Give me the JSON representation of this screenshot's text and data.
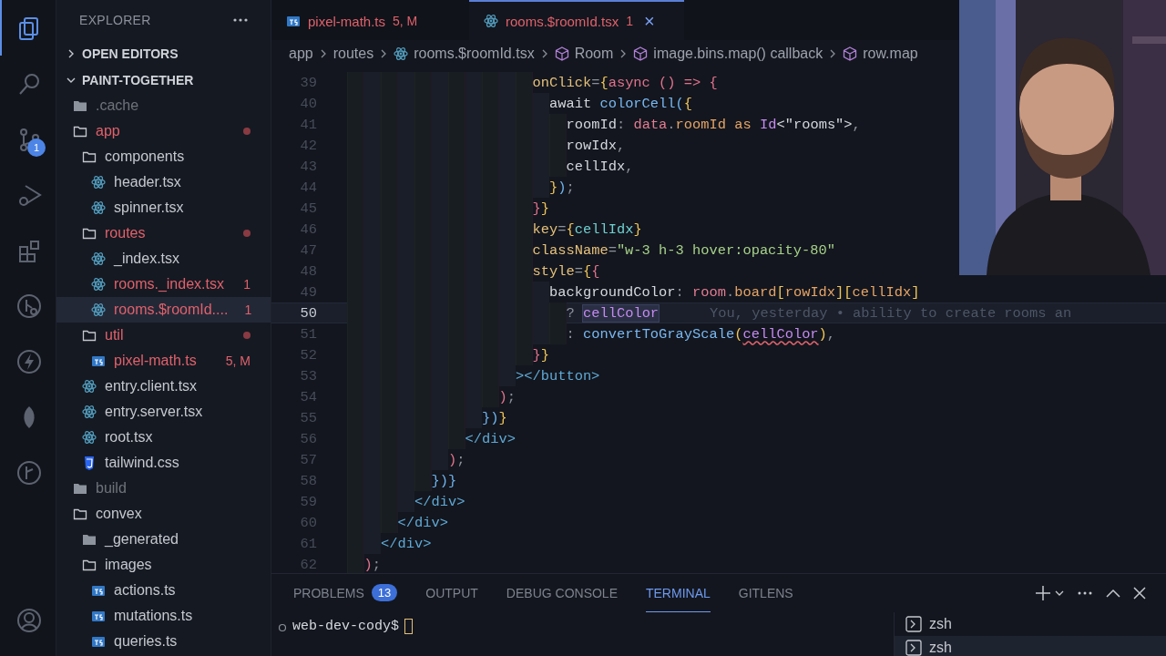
{
  "activity_bar": [
    {
      "kind": "files",
      "selected": true
    },
    {
      "kind": "search",
      "selected": false
    },
    {
      "kind": "source-control",
      "selected": false,
      "badge": "1"
    },
    {
      "kind": "run-debug",
      "selected": false
    },
    {
      "kind": "extensions",
      "selected": false
    },
    {
      "kind": "remote",
      "selected": false
    },
    {
      "kind": "lightning",
      "selected": false
    },
    {
      "kind": "leaf",
      "selected": false
    },
    {
      "kind": "git",
      "selected": false
    },
    {
      "kind": "account",
      "selected": false
    }
  ],
  "sidebar": {
    "title": "EXPLORER",
    "sections": [
      {
        "label": "OPEN EDITORS",
        "expanded": false
      },
      {
        "label": "PAINT-TOGETHER",
        "expanded": true
      }
    ],
    "items": [
      {
        "name": ".cache",
        "kind": "folder-filled",
        "modified": false,
        "ignored": true,
        "selected": false
      },
      {
        "name": "app",
        "kind": "folder",
        "modified": true,
        "ignored": false,
        "dot": true,
        "selected": false,
        "children": [
          {
            "name": "components",
            "kind": "folder",
            "modified": false,
            "ignored": false,
            "selected": false,
            "children": [
              {
                "name": "header.tsx",
                "kind": "react",
                "modified": false,
                "ignored": false,
                "selected": false
              },
              {
                "name": "spinner.tsx",
                "kind": "react",
                "modified": false,
                "ignored": false,
                "selected": false
              }
            ]
          },
          {
            "name": "routes",
            "kind": "folder",
            "modified": true,
            "ignored": false,
            "dot": true,
            "selected": false,
            "children": [
              {
                "name": "_index.tsx",
                "kind": "react",
                "modified": false,
                "ignored": false,
                "selected": false
              },
              {
                "name": "rooms._index.tsx",
                "kind": "react",
                "modified": true,
                "ignored": false,
                "badge": "1",
                "selected": false
              },
              {
                "name": "rooms.$roomId....",
                "kind": "react",
                "modified": true,
                "ignored": false,
                "badge": "1",
                "selected": true
              }
            ]
          },
          {
            "name": "util",
            "kind": "folder",
            "modified": true,
            "ignored": false,
            "dot": true,
            "selected": false,
            "children": [
              {
                "name": "pixel-math.ts",
                "kind": "ts",
                "modified": true,
                "ignored": false,
                "badge": "5, M",
                "selected": false
              }
            ]
          },
          {
            "name": "entry.client.tsx",
            "kind": "react",
            "modified": false,
            "ignored": false,
            "selected": false
          },
          {
            "name": "entry.server.tsx",
            "kind": "react",
            "modified": false,
            "ignored": false,
            "selected": false
          },
          {
            "name": "root.tsx",
            "kind": "react",
            "modified": false,
            "ignored": false,
            "selected": false
          },
          {
            "name": "tailwind.css",
            "kind": "css",
            "modified": false,
            "ignored": false,
            "selected": false
          }
        ]
      },
      {
        "name": "build",
        "kind": "folder-filled",
        "modified": false,
        "ignored": true,
        "selected": false
      },
      {
        "name": "convex",
        "kind": "folder",
        "modified": false,
        "ignored": false,
        "selected": false,
        "children": [
          {
            "name": "_generated",
            "kind": "folder-filled",
            "modified": false,
            "ignored": false,
            "selected": false
          },
          {
            "name": "images",
            "kind": "folder",
            "modified": false,
            "ignored": false,
            "selected": false,
            "children": [
              {
                "name": "actions.ts",
                "kind": "ts",
                "modified": false,
                "ignored": false,
                "selected": false
              },
              {
                "name": "mutations.ts",
                "kind": "ts",
                "modified": false,
                "ignored": false,
                "selected": false
              },
              {
                "name": "queries.ts",
                "kind": "ts",
                "modified": false,
                "ignored": false,
                "selected": false
              }
            ]
          }
        ]
      }
    ]
  },
  "tabs": [
    {
      "label": "pixel-math.ts",
      "kind": "ts",
      "badge": "5, M",
      "selected": false
    },
    {
      "label": "rooms.$roomId.tsx",
      "kind": "react",
      "badge": "1",
      "selected": true,
      "close": "×"
    }
  ],
  "breadcrumb": [
    {
      "text": "app"
    },
    {
      "text": "routes"
    },
    {
      "text": "rooms.$roomId.tsx",
      "kind": "react"
    },
    {
      "text": "Room",
      "kind": "symbol"
    },
    {
      "text": "image.bins.map() callback",
      "kind": "symbol"
    },
    {
      "text": "row.map",
      "kind": "symbol"
    }
  ],
  "editor": {
    "lines": [
      {
        "children": [
          {
            "children": [
              {
                "children": [
                  {
                    "children": [
                      {
                        "children": [
                          {
                            "children": [
                              {
                                "children": [
                                  {
                                    "children": [
                                      {
                                        "children": [
                                          {
                                            "children": [
                                              {
                                                "children": [
                                                  {
                                                    "number": "39",
                                                    "current": false,
                                                    "tokens": [
                                                      {
                                                        "text": "onClick",
                                                        "kind": "attr"
                                                      },
                                                      {
                                                        "text": "=",
                                                        "kind": "punct"
                                                      },
                                                      {
                                                        "text": "{",
                                                        "kind": "b1"
                                                      },
                                                      {
                                                        "text": "async ",
                                                        "kind": "keyword"
                                                      },
                                                      {
                                                        "text": "()",
                                                        "kind": "b2"
                                                      },
                                                      {
                                                        "text": " => ",
                                                        "kind": "keyword"
                                                      },
                                                      {
                                                        "text": "{",
                                                        "kind": "b2"
                                                      }
                                                    ]
                                                  },
                                                  {
                                                    "children": [
                                                      {
                                                        "number": "40",
                                                        "current": false,
                                                        "tokens": [
                                                          {
                                                            "text": "await ",
                                                            "kind": "plain"
                                                          },
                                                          {
                                                            "text": "colorCell",
                                                            "kind": "func"
                                                          },
                                                          {
                                                            "text": "(",
                                                            "kind": "b3"
                                                          },
                                                          {
                                                            "text": "{",
                                                            "kind": "b1"
                                                          }
                                                        ]
                                                      },
                                                      {
                                                        "children": [
                                                          {
                                                            "number": "41",
                                                            "current": false,
                                                            "tokens": [
                                                              {
                                                                "text": "roomId",
                                                                "kind": "plain"
                                                              },
                                                              {
                                                                "text": ": ",
                                                                "kind": "punct"
                                                              },
                                                              {
                                                                "text": "data",
                                                                "kind": "var"
                                                              },
                                                              {
                                                                "text": ".",
                                                                "kind": "punct"
                                                              },
                                                              {
                                                                "text": "roomId",
                                                                "kind": "prop"
                                                              },
                                                              {
                                                                "text": " as ",
                                                                "kind": "prop"
                                                              },
                                                              {
                                                                "text": "Id",
                                                                "kind": "type"
                                                              },
                                                              {
                                                                "text": "<\"rooms\">",
                                                                "kind": "plain"
                                                              },
                                                              {
                                                                "text": ",",
                                                                "kind": "punct"
                                                              }
                                                            ]
                                                          },
                                                          {
                                                            "number": "42",
                                                            "current": false,
                                                            "tokens": [
                                                              {
                                                                "text": "rowIdx",
                                                                "kind": "plain"
                                                              },
                                                              {
                                                                "text": ",",
                                                                "kind": "punct"
                                                              }
                                                            ]
                                                          },
                                                          {
                                                            "number": "43",
                                                            "current": false,
                                                            "tokens": [
                                                              {
                                                                "text": "cellIdx",
                                                                "kind": "plain"
                                                              },
                                                              {
                                                                "text": ",",
                                                                "kind": "punct"
                                                              }
                                                            ]
                                                          }
                                                        ]
                                                      },
                                                      {
                                                        "number": "44",
                                                        "current": false,
                                                        "tokens": [
                                                          {
                                                            "text": "}",
                                                            "kind": "b1"
                                                          },
                                                          {
                                                            "text": ")",
                                                            "kind": "b3"
                                                          },
                                                          {
                                                            "text": ";",
                                                            "kind": "punct"
                                                          }
                                                        ]
                                                      }
                                                    ]
                                                  },
                                                  {
                                                    "number": "45",
                                                    "current": false,
                                                    "tokens": [
                                                      {
                                                        "text": "}",
                                                        "kind": "b2"
                                                      },
                                                      {
                                                        "text": "}",
                                                        "kind": "b1"
                                                      }
                                                    ]
                                                  },
                                                  {
                                                    "number": "46",
                                                    "current": false,
                                                    "tokens": [
                                                      {
                                                        "text": "key",
                                                        "kind": "attr"
                                                      },
                                                      {
                                                        "text": "=",
                                                        "kind": "punct"
                                                      },
                                                      {
                                                        "text": "{",
                                                        "kind": "b1"
                                                      },
                                                      {
                                                        "text": "cellIdx",
                                                        "kind": "cyan"
                                                      },
                                                      {
                                                        "text": "}",
                                                        "kind": "b1"
                                                      }
                                                    ]
                                                  },
                                                  {
                                                    "number": "47",
                                                    "current": false,
                                                    "tokens": [
                                                      {
                                                        "text": "className",
                                                        "kind": "attr"
                                                      },
                                                      {
                                                        "text": "=",
                                                        "kind": "punct"
                                                      },
                                                      {
                                                        "text": "\"w-3 h-3 hover:opacity-80\"",
                                                        "kind": "string"
                                                      }
                                                    ]
                                                  },
                                                  {
                                                    "number": "48",
                                                    "current": false,
                                                    "tokens": [
                                                      {
                                                        "text": "style",
                                                        "kind": "attr"
                                                      },
                                                      {
                                                        "text": "=",
                                                        "kind": "punct"
                                                      },
                                                      {
                                                        "text": "{",
                                                        "kind": "b1"
                                                      },
                                                      {
                                                        "text": "{",
                                                        "kind": "b2"
                                                      }
                                                    ]
                                                  },
                                                  {
                                                    "children": [
                                                      {
                                                        "number": "49",
                                                        "current": false,
                                                        "tokens": [
                                                          {
                                                            "text": "backgroundColor",
                                                            "kind": "plain"
                                                          },
                                                          {
                                                            "text": ": ",
                                                            "kind": "punct"
                                                          },
                                                          {
                                                            "text": "room",
                                                            "kind": "var"
                                                          },
                                                          {
                                                            "text": ".",
                                                            "kind": "punct"
                                                          },
                                                          {
                                                            "text": "board",
                                                            "kind": "prop"
                                                          },
                                                          {
                                                            "text": "[",
                                                            "kind": "b1"
                                                          },
                                                          {
                                                            "text": "rowIdx",
                                                            "kind": "prop"
                                                          },
                                                          {
                                                            "text": "]",
                                                            "kind": "b1"
                                                          },
                                                          {
                                                            "text": "[",
                                                            "kind": "b1"
                                                          },
                                                          {
                                                            "text": "cellIdx",
                                                            "kind": "prop"
                                                          },
                                                          {
                                                            "text": "]",
                                                            "kind": "b1"
                                                          }
                                                        ]
                                                      },
                                                      {
                                                        "children": [
                                                          {
                                                            "number": "50",
                                                            "current": true,
                                                            "blame": "You, yesterday • ability to create rooms an",
                                                            "tokens": [
                                                              {
                                                                "text": "? ",
                                                                "kind": "punct"
                                                              },
                                                              {
                                                                "text": "cellColor",
                                                                "kind": "highlight"
                                                              }
                                                            ]
                                                          },
                                                          {
                                                            "number": "51",
                                                            "current": false,
                                                            "tokens": [
                                                              {
                                                                "text": ": ",
                                                                "kind": "punct"
                                                              },
                                                              {
                                                                "text": "convertToGrayScale",
                                                                "kind": "func"
                                                              },
                                                              {
                                                                "text": "(",
                                                                "kind": "b1"
                                                              },
                                                              {
                                                                "text": "cellColor",
                                                                "kind": "error"
                                                              },
                                                              {
                                                                "text": ")",
                                                                "kind": "b1"
                                                              },
                                                              {
                                                                "text": ",",
                                                                "kind": "punct"
                                                              }
                                                            ]
                                                          }
                                                        ]
                                                      }
                                                    ]
                                                  },
                                                  {
                                                    "number": "52",
                                                    "current": false,
                                                    "tokens": [
                                                      {
                                                        "text": "}",
                                                        "kind": "b2"
                                                      },
                                                      {
                                                        "text": "}",
                                                        "kind": "b1"
                                                      }
                                                    ]
                                                  }
                                                ]
                                              },
                                              {
                                                "number": "53",
                                                "current": false,
                                                "tokens": [
                                                  {
                                                    "text": "></button>",
                                                    "kind": "tag"
                                                  }
                                                ]
                                              }
                                            ]
                                          },
                                          {
                                            "number": "54",
                                            "current": false,
                                            "tokens": [
                                              {
                                                "text": ")",
                                                "kind": "b2"
                                              },
                                              {
                                                "text": ";",
                                                "kind": "punct"
                                              }
                                            ]
                                          }
                                        ]
                                      },
                                      {
                                        "number": "55",
                                        "current": false,
                                        "tokens": [
                                          {
                                            "text": "})",
                                            "kind": "b3"
                                          },
                                          {
                                            "text": "}",
                                            "kind": "b1"
                                          }
                                        ]
                                      }
                                    ]
                                  },
                                  {
                                    "number": "56",
                                    "current": false,
                                    "tokens": [
                                      {
                                        "text": "</div>",
                                        "kind": "tag"
                                      }
                                    ]
                                  }
                                ]
                              },
                              {
                                "number": "57",
                                "current": false,
                                "tokens": [
                                  {
                                    "text": ")",
                                    "kind": "b2"
                                  },
                                  {
                                    "text": ";",
                                    "kind": "punct"
                                  }
                                ]
                              }
                            ]
                          },
                          {
                            "number": "58",
                            "current": false,
                            "tokens": [
                              {
                                "text": "})}",
                                "kind": "b3"
                              }
                            ]
                          }
                        ]
                      },
                      {
                        "number": "59",
                        "current": false,
                        "tokens": [
                          {
                            "text": "</div>",
                            "kind": "tag"
                          }
                        ]
                      }
                    ]
                  },
                  {
                    "number": "60",
                    "current": false,
                    "tokens": [
                      {
                        "text": "</div>",
                        "kind": "tag"
                      }
                    ]
                  }
                ]
              },
              {
                "number": "61",
                "current": false,
                "tokens": [
                  {
                    "text": "</div>",
                    "kind": "tag"
                  }
                ]
              }
            ]
          },
          {
            "number": "62",
            "current": false,
            "tokens": [
              {
                "text": ")",
                "kind": "b2"
              },
              {
                "text": ";",
                "kind": "punct"
              }
            ]
          }
        ]
      }
    ]
  },
  "panel": {
    "tabs": [
      {
        "label": "PROBLEMS",
        "badge": "13",
        "selected": false
      },
      {
        "label": "OUTPUT",
        "selected": false
      },
      {
        "label": "DEBUG CONSOLE",
        "selected": false
      },
      {
        "label": "TERMINAL",
        "selected": true
      },
      {
        "label": "GITLENS",
        "selected": false
      }
    ],
    "prompt": "web-dev-cody$",
    "terminals": [
      {
        "label": "zsh",
        "selected": false
      },
      {
        "label": "zsh",
        "selected": true
      }
    ]
  }
}
